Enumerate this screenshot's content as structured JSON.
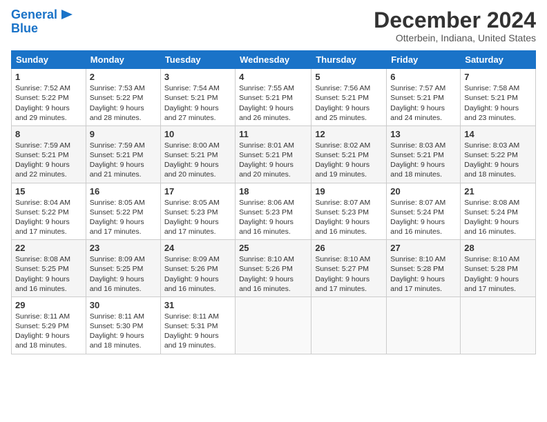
{
  "logo": {
    "line1": "General",
    "line2": "Blue"
  },
  "title": "December 2024",
  "location": "Otterbein, Indiana, United States",
  "days_header": [
    "Sunday",
    "Monday",
    "Tuesday",
    "Wednesday",
    "Thursday",
    "Friday",
    "Saturday"
  ],
  "weeks": [
    [
      {
        "day": "1",
        "info": "Sunrise: 7:52 AM\nSunset: 5:22 PM\nDaylight: 9 hours\nand 29 minutes."
      },
      {
        "day": "2",
        "info": "Sunrise: 7:53 AM\nSunset: 5:22 PM\nDaylight: 9 hours\nand 28 minutes."
      },
      {
        "day": "3",
        "info": "Sunrise: 7:54 AM\nSunset: 5:21 PM\nDaylight: 9 hours\nand 27 minutes."
      },
      {
        "day": "4",
        "info": "Sunrise: 7:55 AM\nSunset: 5:21 PM\nDaylight: 9 hours\nand 26 minutes."
      },
      {
        "day": "5",
        "info": "Sunrise: 7:56 AM\nSunset: 5:21 PM\nDaylight: 9 hours\nand 25 minutes."
      },
      {
        "day": "6",
        "info": "Sunrise: 7:57 AM\nSunset: 5:21 PM\nDaylight: 9 hours\nand 24 minutes."
      },
      {
        "day": "7",
        "info": "Sunrise: 7:58 AM\nSunset: 5:21 PM\nDaylight: 9 hours\nand 23 minutes."
      }
    ],
    [
      {
        "day": "8",
        "info": "Sunrise: 7:59 AM\nSunset: 5:21 PM\nDaylight: 9 hours\nand 22 minutes."
      },
      {
        "day": "9",
        "info": "Sunrise: 7:59 AM\nSunset: 5:21 PM\nDaylight: 9 hours\nand 21 minutes."
      },
      {
        "day": "10",
        "info": "Sunrise: 8:00 AM\nSunset: 5:21 PM\nDaylight: 9 hours\nand 20 minutes."
      },
      {
        "day": "11",
        "info": "Sunrise: 8:01 AM\nSunset: 5:21 PM\nDaylight: 9 hours\nand 20 minutes."
      },
      {
        "day": "12",
        "info": "Sunrise: 8:02 AM\nSunset: 5:21 PM\nDaylight: 9 hours\nand 19 minutes."
      },
      {
        "day": "13",
        "info": "Sunrise: 8:03 AM\nSunset: 5:21 PM\nDaylight: 9 hours\nand 18 minutes."
      },
      {
        "day": "14",
        "info": "Sunrise: 8:03 AM\nSunset: 5:22 PM\nDaylight: 9 hours\nand 18 minutes."
      }
    ],
    [
      {
        "day": "15",
        "info": "Sunrise: 8:04 AM\nSunset: 5:22 PM\nDaylight: 9 hours\nand 17 minutes."
      },
      {
        "day": "16",
        "info": "Sunrise: 8:05 AM\nSunset: 5:22 PM\nDaylight: 9 hours\nand 17 minutes."
      },
      {
        "day": "17",
        "info": "Sunrise: 8:05 AM\nSunset: 5:23 PM\nDaylight: 9 hours\nand 17 minutes."
      },
      {
        "day": "18",
        "info": "Sunrise: 8:06 AM\nSunset: 5:23 PM\nDaylight: 9 hours\nand 16 minutes."
      },
      {
        "day": "19",
        "info": "Sunrise: 8:07 AM\nSunset: 5:23 PM\nDaylight: 9 hours\nand 16 minutes."
      },
      {
        "day": "20",
        "info": "Sunrise: 8:07 AM\nSunset: 5:24 PM\nDaylight: 9 hours\nand 16 minutes."
      },
      {
        "day": "21",
        "info": "Sunrise: 8:08 AM\nSunset: 5:24 PM\nDaylight: 9 hours\nand 16 minutes."
      }
    ],
    [
      {
        "day": "22",
        "info": "Sunrise: 8:08 AM\nSunset: 5:25 PM\nDaylight: 9 hours\nand 16 minutes."
      },
      {
        "day": "23",
        "info": "Sunrise: 8:09 AM\nSunset: 5:25 PM\nDaylight: 9 hours\nand 16 minutes."
      },
      {
        "day": "24",
        "info": "Sunrise: 8:09 AM\nSunset: 5:26 PM\nDaylight: 9 hours\nand 16 minutes."
      },
      {
        "day": "25",
        "info": "Sunrise: 8:10 AM\nSunset: 5:26 PM\nDaylight: 9 hours\nand 16 minutes."
      },
      {
        "day": "26",
        "info": "Sunrise: 8:10 AM\nSunset: 5:27 PM\nDaylight: 9 hours\nand 17 minutes."
      },
      {
        "day": "27",
        "info": "Sunrise: 8:10 AM\nSunset: 5:28 PM\nDaylight: 9 hours\nand 17 minutes."
      },
      {
        "day": "28",
        "info": "Sunrise: 8:10 AM\nSunset: 5:28 PM\nDaylight: 9 hours\nand 17 minutes."
      }
    ],
    [
      {
        "day": "29",
        "info": "Sunrise: 8:11 AM\nSunset: 5:29 PM\nDaylight: 9 hours\nand 18 minutes."
      },
      {
        "day": "30",
        "info": "Sunrise: 8:11 AM\nSunset: 5:30 PM\nDaylight: 9 hours\nand 18 minutes."
      },
      {
        "day": "31",
        "info": "Sunrise: 8:11 AM\nSunset: 5:31 PM\nDaylight: 9 hours\nand 19 minutes."
      },
      {
        "day": "",
        "info": ""
      },
      {
        "day": "",
        "info": ""
      },
      {
        "day": "",
        "info": ""
      },
      {
        "day": "",
        "info": ""
      }
    ]
  ]
}
